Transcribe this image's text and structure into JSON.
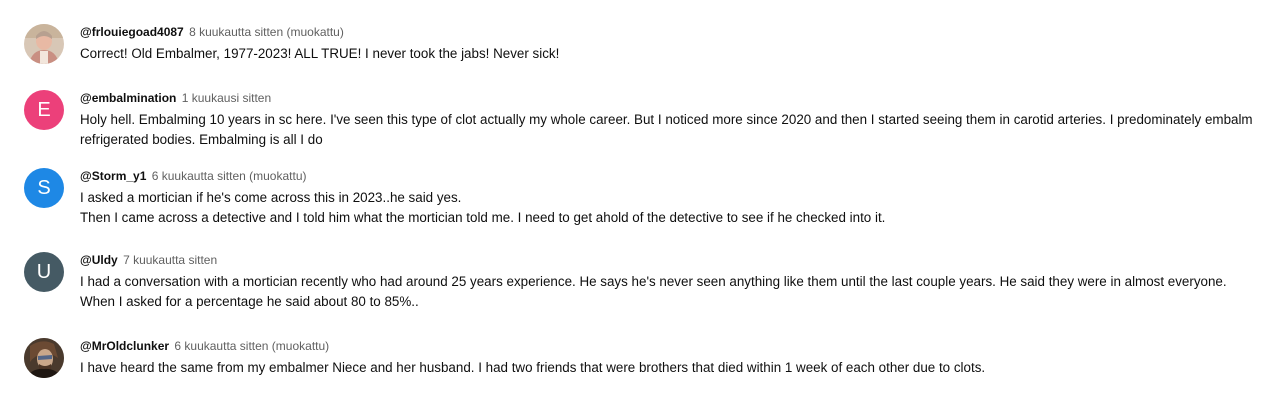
{
  "comments": [
    {
      "author": "@frlouiegoad4087",
      "time": "8 kuukautta sitten (muokattu)",
      "lines": [
        "Correct! Old Embalmer, 1977-2023!  ALL TRUE! I never took the jabs! Never sick!"
      ],
      "avatar": {
        "type": "photo",
        "icon": "user-photo-portrait"
      }
    },
    {
      "author": "@embalmination",
      "time": "1 kuukausi sitten",
      "lines": [
        "Holy hell. Embalming 10 years in sc here. I've seen this type of clot actually my whole career. But I noticed more since 2020 and then I started seeing them in carotid arteries. I predominately embalm refrigerated bodies. Embalming is all I do"
      ],
      "avatar": {
        "type": "letter",
        "letter": "E",
        "color": "#ec407a"
      }
    },
    {
      "author": "@Storm_y1",
      "time": "6 kuukautta sitten (muokattu)",
      "lines": [
        "I asked a mortician if he's come across this in 2023..he said yes.",
        "Then I came across a detective and I told him what the mortician told me. I need to get ahold of the detective to see if he checked into it."
      ],
      "avatar": {
        "type": "letter",
        "letter": "S",
        "color": "#1e88e5"
      }
    },
    {
      "author": "@Uldy",
      "time": "7 kuukautta sitten",
      "lines": [
        "I had a conversation with a mortician recently who had around 25 years experience. He says he's never seen anything like them until the last couple years. He said they were in almost everyone.",
        "When I asked for a percentage he said about 80 to 85%.."
      ],
      "avatar": {
        "type": "letter",
        "letter": "U",
        "color": "#455a64"
      }
    },
    {
      "author": "@MrOldclunker",
      "time": "6 kuukautta sitten (muokattu)",
      "lines": [
        "I have heard the same from my embalmer Niece and her husband.  I had two friends that were brothers that died within 1 week of each other due to clots."
      ],
      "avatar": {
        "type": "photo",
        "icon": "user-photo-warrior"
      }
    }
  ]
}
